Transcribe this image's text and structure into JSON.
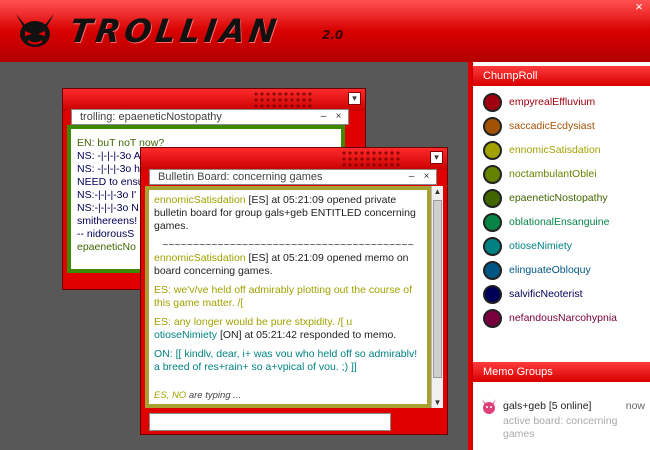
{
  "app": {
    "name": "TROLLIAN",
    "version": "2.0",
    "close_glyph": "×"
  },
  "chumproll": {
    "header": "ChumpRoll",
    "chums": [
      {
        "handle": "empyrealEffluvium",
        "color": "#a1000f"
      },
      {
        "handle": "saccadicEcdysiast",
        "color": "#a25203"
      },
      {
        "handle": "ennomicSatisdation",
        "color": "#a1a100"
      },
      {
        "handle": "noctambulantOblei",
        "color": "#658200"
      },
      {
        "handle": "epaeneticNostopathy",
        "color": "#416600"
      },
      {
        "handle": "oblationalEnsanguine",
        "color": "#078446"
      },
      {
        "handle": "otioseNimiety",
        "color": "#008282"
      },
      {
        "handle": "elinguateObloquy",
        "color": "#005682"
      },
      {
        "handle": "salvificNeoterist",
        "color": "#000056"
      },
      {
        "handle": "nefandousNarcohypnia",
        "color": "#77003c"
      }
    ]
  },
  "memo_groups": {
    "header": "Memo Groups",
    "items": [
      {
        "name": "gals+geb [5 online]",
        "time": "now",
        "board": "active board: concerning games"
      }
    ]
  },
  "trolling_window": {
    "title": "trolling: epaeneticNostopathy",
    "lines": [
      {
        "text": "EN: buT noT now?",
        "color": "#416600"
      },
      {
        "text": "NS: -|-|-|-3o A",
        "color": "#000056"
      },
      {
        "text": "NS: -|-|-|-3o h",
        "color": "#000056"
      },
      {
        "text": "NEED to ensu",
        "color": "#000056"
      },
      {
        "text": "NS:-|-|-|-3o I'",
        "color": "#000056"
      },
      {
        "text": "NS:-|-|-|-3o N",
        "color": "#000056"
      },
      {
        "text": "smithereens!",
        "color": "#000056"
      },
      {
        "text": "-- nidorousS",
        "color": "#000056"
      },
      {
        "text": "epaeneticNo",
        "color": "#416600"
      }
    ]
  },
  "bulletin_window": {
    "title": "Bulletin Board: concerning games",
    "entries": [
      {
        "handle": "ennomicSatisdation",
        "rest": " [ES] at 05:21:09 opened private bulletin board for group gals+geb ENTITLED concerning games.",
        "color": "#a1a100"
      },
      {
        "divider": "~~~~~~~~~~~~~~~~~~~~~~~~~~~~~~~~~~~~~~~~~"
      },
      {
        "handle": "ennomicSatisdation",
        "rest": " [ES] at 05:21:09 opened memo on board concerning games.",
        "color": "#a1a100"
      },
      {
        "text": "ES: we'v/ve held off admirably plotting out the course of this game matter. /[",
        "color": "#a1a100"
      },
      {
        "text": "ES: any longer would be pure stxpidity. /[ u",
        "color": "#a1a100"
      },
      {
        "handle": "otioseNimiety",
        "rest": " [ON] at 05:21:42 responded to memo.",
        "color": "#008282"
      },
      {
        "text": "ON: [[ kindlv, dear, i+ was vou who held off so admirablv! a breed of res+rain+ so a+vpical of vou. ;) ]]",
        "color": "#008282"
      }
    ],
    "typing": {
      "who": "ES, NO",
      "suffix": " are typing ..."
    }
  }
}
